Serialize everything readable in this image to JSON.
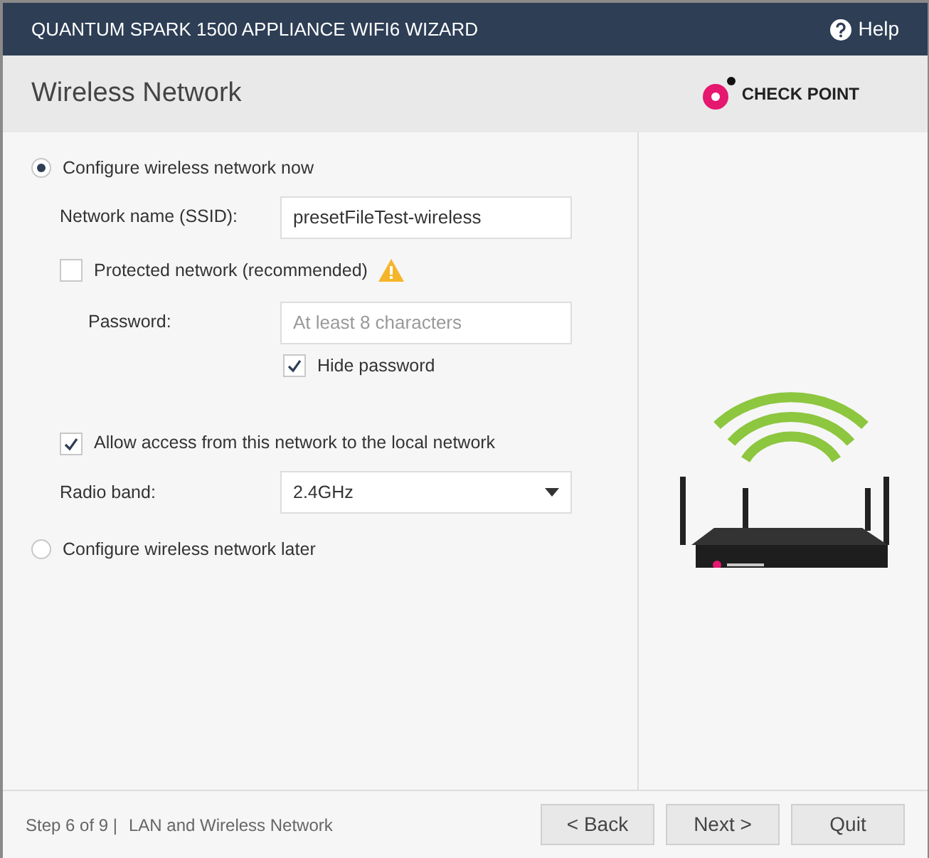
{
  "window": {
    "title": "QUANTUM SPARK 1500 APPLIANCE WIFI6 WIZARD",
    "help": "Help"
  },
  "page": {
    "title": "Wireless Network",
    "logo": "CHECK POINT"
  },
  "options": [
    {
      "label": "Configure wireless network now",
      "selected": true
    },
    {
      "label": "Configure wireless network later",
      "selected": false
    }
  ],
  "ssid": {
    "label": "Network name (SSID):",
    "value": "presetFileTest-wireless"
  },
  "protected": {
    "label": "Protected network (recommended)",
    "checked": false,
    "warning": true
  },
  "password": {
    "label": "Password:",
    "placeholder": "At least 8 characters"
  },
  "hide_password": {
    "label": "Hide password",
    "checked": true
  },
  "allow_access": {
    "label": "Allow access from this network to the local network",
    "checked": true
  },
  "radio_band": {
    "label": "Radio band:",
    "value": "2.4GHz"
  },
  "footer": {
    "step": "Step 6 of 9 |",
    "section": "LAN and Wireless Network",
    "buttons": [
      "< Back",
      "Next >",
      "Quit"
    ]
  }
}
